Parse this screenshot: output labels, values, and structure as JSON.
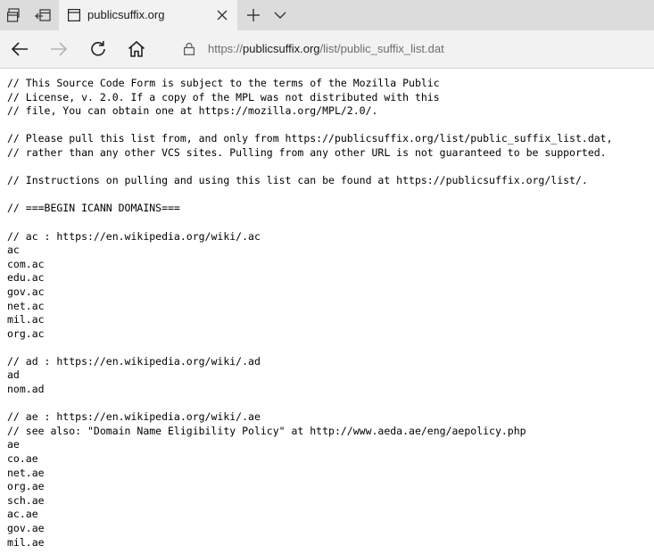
{
  "browser": {
    "tab": {
      "title": "publicsuffix.org"
    },
    "address": {
      "scheme": "https://",
      "host": "publicsuffix.org",
      "path": "/list/public_suffix_list.dat"
    }
  },
  "icons": {
    "tab_actions": "tab-actions-icon",
    "set_aside_tabs": "set-aside-tabs-icon",
    "favicon": "page-favicon-icon",
    "close": "close-icon",
    "new_tab": "plus-icon",
    "tab_list": "chevron-down-icon",
    "back": "back-arrow-icon",
    "forward": "forward-arrow-icon",
    "refresh": "refresh-icon",
    "home": "home-icon",
    "lock": "lock-icon"
  },
  "content": {
    "lines": [
      "// This Source Code Form is subject to the terms of the Mozilla Public",
      "// License, v. 2.0. If a copy of the MPL was not distributed with this",
      "// file, You can obtain one at https://mozilla.org/MPL/2.0/.",
      "",
      "// Please pull this list from, and only from https://publicsuffix.org/list/public_suffix_list.dat,",
      "// rather than any other VCS sites. Pulling from any other URL is not guaranteed to be supported.",
      "",
      "// Instructions on pulling and using this list can be found at https://publicsuffix.org/list/.",
      "",
      "// ===BEGIN ICANN DOMAINS===",
      "",
      "// ac : https://en.wikipedia.org/wiki/.ac",
      "ac",
      "com.ac",
      "edu.ac",
      "gov.ac",
      "net.ac",
      "mil.ac",
      "org.ac",
      "",
      "// ad : https://en.wikipedia.org/wiki/.ad",
      "ad",
      "nom.ad",
      "",
      "// ae : https://en.wikipedia.org/wiki/.ae",
      "// see also: \"Domain Name Eligibility Policy\" at http://www.aeda.ae/eng/aepolicy.php",
      "ae",
      "co.ae",
      "net.ae",
      "org.ae",
      "sch.ae",
      "ac.ae",
      "gov.ae",
      "mil.ae"
    ]
  }
}
